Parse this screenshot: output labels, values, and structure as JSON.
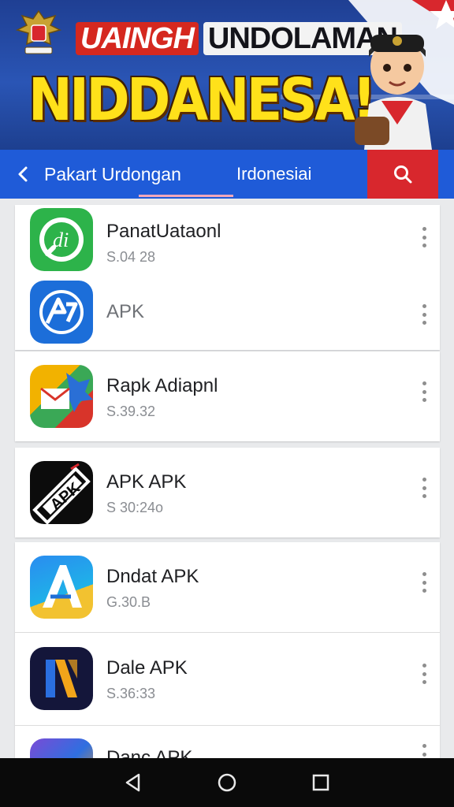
{
  "banner": {
    "line1_red": "UAINGH",
    "line1_white": "UNDOLAMAN",
    "line2": "NIDDANESA!"
  },
  "appbar": {
    "title": "Pakart Urdongan",
    "subtitle": "Irdonesiai",
    "back_icon": "chevron-left-icon",
    "search_icon": "search-icon"
  },
  "apps": [
    {
      "name": "PanatUataonl",
      "meta": "S.04 28",
      "icon": "green-speech-icon"
    },
    {
      "name": "APK",
      "meta": "",
      "icon": "blue-apk-icon"
    },
    {
      "name": "Rapk Adiapnl",
      "meta": "S.39.32",
      "icon": "mail-envelope-icon"
    },
    {
      "name": "APK APK",
      "meta": "S 30:24o",
      "icon": "apk-ticket-icon"
    },
    {
      "name": "Dndat APK",
      "meta": "G.30.B",
      "icon": "letter-a-icon"
    },
    {
      "name": "Dale APK",
      "meta": "S.36:33",
      "icon": "letter-n-icon"
    },
    {
      "name": "Danc APK",
      "meta": "",
      "icon": "partial-app-icon"
    }
  ],
  "navbar": {
    "back_icon": "nav-back-icon",
    "home_icon": "nav-home-icon",
    "recents_icon": "nav-recents-icon"
  },
  "colors": {
    "appbar": "#1f5bd8",
    "search_bg": "#d8272d",
    "banner_yellow": "#ffe11a"
  }
}
